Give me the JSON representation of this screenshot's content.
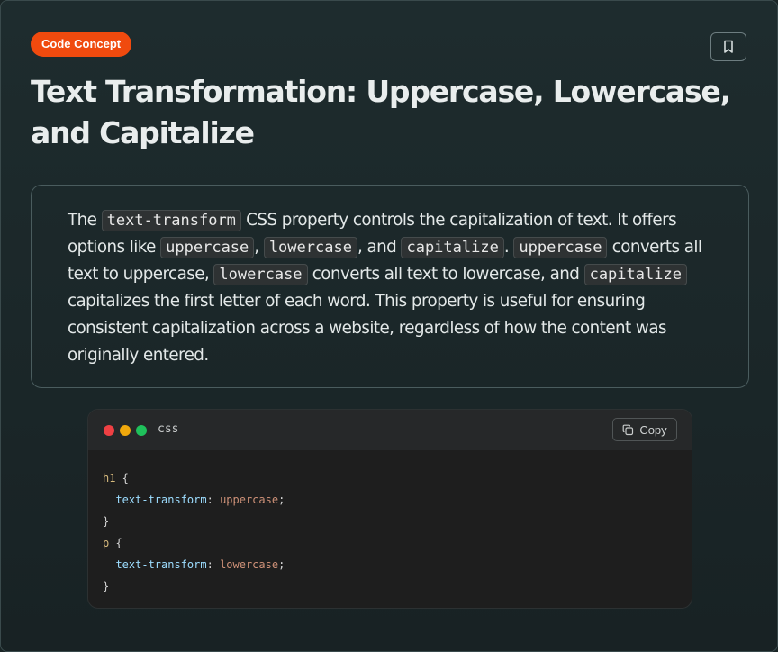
{
  "badge": {
    "label": "Code Concept"
  },
  "title": "Text Transformation: Uppercase, Lowercase, and Capitalize",
  "bookmark": {
    "icon": "bookmark-icon"
  },
  "description": {
    "t1": "The ",
    "c1": "text-transform",
    "t2": " CSS property controls the capitalization of text. It offers options like ",
    "c2": "uppercase",
    "t3": ", ",
    "c3": "lowercase",
    "t4": ", and ",
    "c4": "capitalize",
    "t5": ". ",
    "c5": "uppercase",
    "t6": " converts all text to uppercase, ",
    "c6": "lowercase",
    "t7": " converts all text to lowercase, and ",
    "c7": "capitalize",
    "t8": " capitalizes the first letter of each word. This property is useful for ensuring consistent capitalization across a website, regardless of how the content was originally entered."
  },
  "code": {
    "language": "css",
    "copy_label": "Copy",
    "copy_icon": "copy-icon",
    "lines": {
      "l1_sel": "h1",
      "l1_brace": " {",
      "l2_prop": "text-transform",
      "l2_colon": ": ",
      "l2_val": "uppercase",
      "l2_semi": ";",
      "l3_brace": "}",
      "l4_sel": "p",
      "l4_brace": " {",
      "l5_prop": "text-transform",
      "l5_colon": ": ",
      "l5_val": "lowercase",
      "l5_semi": ";",
      "l6_brace": "}"
    }
  },
  "colors": {
    "badge_bg": "#f04a0e",
    "card_bg": "#1e2c2e",
    "code_bg": "#1e1e1e",
    "selector": "#d7ba7d",
    "property": "#9cdcfe",
    "value": "#ce9178"
  }
}
